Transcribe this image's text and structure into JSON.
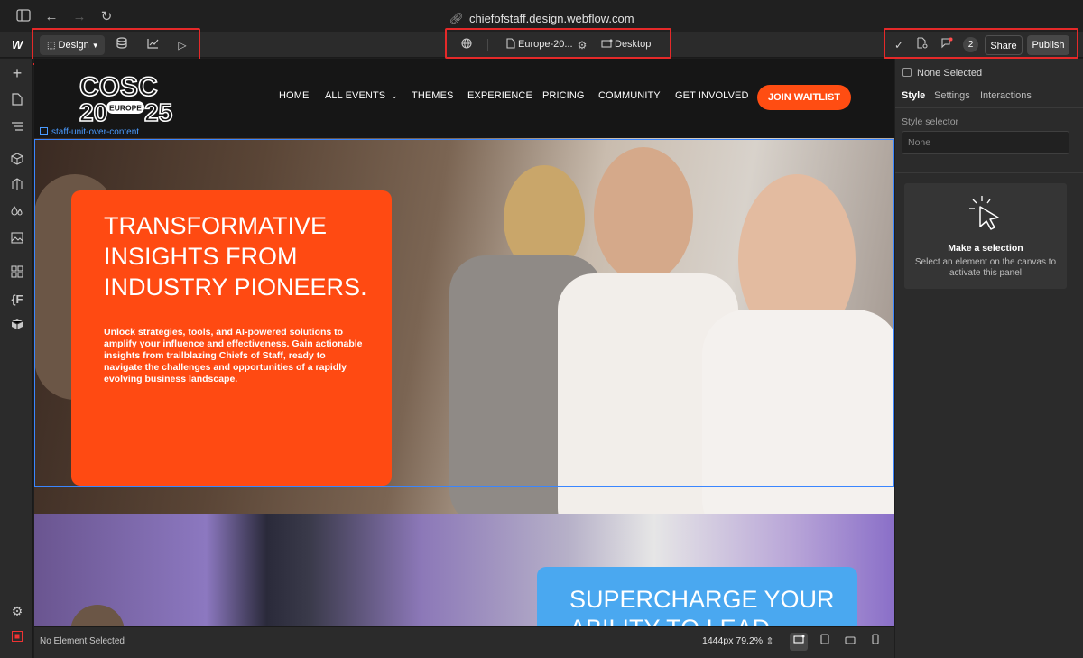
{
  "window": {
    "url": "chiefofstaff.design.webflow.com"
  },
  "toolbar": {
    "mode_label": "Design",
    "page_name": "Europe-20...",
    "breakpoint_label": "Desktop",
    "comment_count": "2",
    "share_label": "Share",
    "publish_label": "Publish"
  },
  "site": {
    "logo_top": "COSC",
    "logo_mid": "EUROPE",
    "logo_left": "20",
    "logo_right": "25",
    "nav": [
      "HOME",
      "ALL EVENTS",
      "THEMES",
      "EXPERIENCE",
      "PRICING",
      "COMMUNITY",
      "GET INVOLVED"
    ],
    "cta": "JOIN WAITLIST",
    "selected_element": "staff-unit-over-content",
    "hero_title": "TRANSFORMATIVE INSIGHTS FROM INDUSTRY PIONEERS.",
    "hero_body": "Unlock strategies, tools, and AI-powered solutions to amplify your influence and effectiveness. Gain actionable insights from trailblazing Chiefs of Staff, ready to navigate the challenges and opportunities of a rapidly evolving business landscape.",
    "section2_title": "SUPERCHARGE YOUR ABILITY TO LEAD"
  },
  "panel": {
    "none_selected": "None Selected",
    "tabs": [
      "Style",
      "Settings",
      "Interactions"
    ],
    "style_selector_label": "Style selector",
    "style_selector_placeholder": "None",
    "empty_title": "Make a selection",
    "empty_desc": "Select an element on the canvas to activate this panel"
  },
  "status": {
    "selection": "No Element Selected",
    "canvas_size": "1444px 79.2%"
  },
  "colors": {
    "accent_orange": "#ff4a12",
    "accent_blue": "#4aa8f0",
    "selection_blue": "#3a86ff",
    "highlight_red": "#e52929"
  }
}
